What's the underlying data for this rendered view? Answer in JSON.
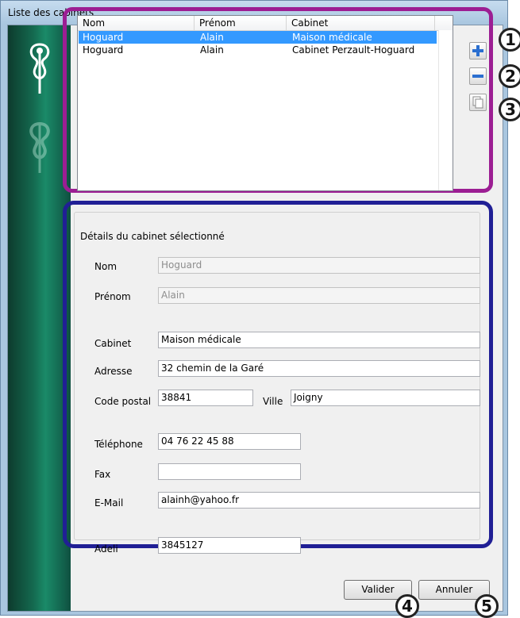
{
  "window": {
    "title": "Liste des cabinets"
  },
  "list": {
    "columns": [
      "Nom",
      "Prénom",
      "Cabinet"
    ],
    "rows": [
      {
        "nom": "Hoguard",
        "prenom": "Alain",
        "cabinet": "Maison médicale",
        "selected": true
      },
      {
        "nom": "Hoguard",
        "prenom": "Alain",
        "cabinet": "Cabinet Perzault-Hoguard",
        "selected": false
      }
    ]
  },
  "side_buttons": {
    "add_icon": "plus-icon",
    "remove_icon": "minus-icon",
    "duplicate_icon": "copy-icon"
  },
  "callouts": [
    "1",
    "2",
    "3",
    "4",
    "5"
  ],
  "details": {
    "legend": "Détails du cabinet sélectionné",
    "nom": {
      "label": "Nom",
      "value": "Hoguard"
    },
    "prenom": {
      "label": "Prénom",
      "value": "Alain"
    },
    "cabinet": {
      "label": "Cabinet",
      "value": "Maison médicale"
    },
    "adresse": {
      "label": "Adresse",
      "value": "32 chemin de la Garé"
    },
    "code_postal": {
      "label": "Code postal",
      "value": "38841"
    },
    "ville": {
      "label": "Ville",
      "value": "Joigny"
    },
    "telephone": {
      "label": "Téléphone",
      "value": "04 76 22 45 88"
    },
    "fax": {
      "label": "Fax",
      "value": ""
    },
    "email": {
      "label": "E-Mail",
      "value": "alainh@yahoo.fr"
    },
    "adeli": {
      "label": "Adeli",
      "value": "3845127"
    }
  },
  "footer": {
    "validate_label": "Valider",
    "cancel_label": "Annuler"
  },
  "colors": {
    "highlight_list": "#9c1e93",
    "highlight_details": "#201f95",
    "selection": "#3399ff"
  }
}
